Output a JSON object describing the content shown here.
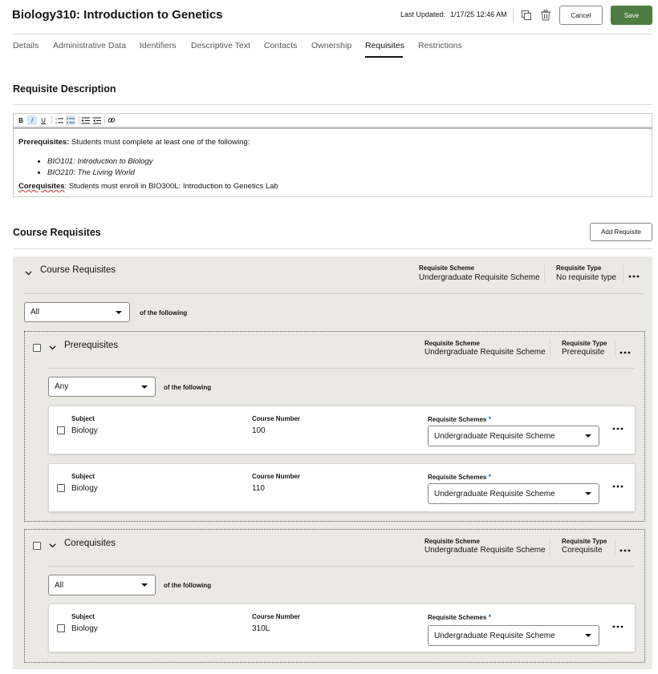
{
  "header": {
    "title": "Biology310: Introduction to Genetics",
    "last_updated_label": "Last Updated:",
    "last_updated_value": "1/17/25 12:46 AM",
    "cancel_label": "Cancel",
    "save_label": "Save"
  },
  "tabs": [
    {
      "label": "Details"
    },
    {
      "label": "Administrative Data"
    },
    {
      "label": "Identifiers"
    },
    {
      "label": "Descriptive Text"
    },
    {
      "label": "Contacts"
    },
    {
      "label": "Ownership"
    },
    {
      "label": "Requisites",
      "active": true
    },
    {
      "label": "Restrictions"
    }
  ],
  "requisite_description": {
    "title": "Requisite Description",
    "toolbar": [
      "B",
      "I",
      "U"
    ],
    "prereq_label": "Prerequisites:",
    "prereq_text": "Students must complete at least one of the following:",
    "bullets": [
      "BIO101: Introduction to Biology",
      "BIO210: The Living World"
    ],
    "coreq_label": "Corequisites",
    "coreq_text": ": Students must enroll in BIO300L: Introduction to Genetics Lab"
  },
  "course_requisites": {
    "title": "Course Requisites",
    "add_button": "Add Requisite",
    "group": {
      "title": "Course Requisites",
      "scheme_label": "Requisite Scheme",
      "scheme_value": "Undergraduate Requisite Scheme",
      "type_label": "Requisite Type",
      "type_value": "No requisite type",
      "operator": "All",
      "of_following": "of the following"
    },
    "prerequisites": {
      "title": "Prerequisites",
      "scheme_label": "Requisite Scheme",
      "scheme_value": "Undergraduate Requisite Scheme",
      "type_label": "Requisite Type",
      "type_value": "Prerequisite",
      "operator": "Any",
      "of_following": "of the following",
      "courses": [
        {
          "subject_label": "Subject",
          "subject": "Biology",
          "number_label": "Course Number",
          "number": "100",
          "schemes_label": "Requisite Schemes",
          "scheme": "Undergraduate Requisite Scheme"
        },
        {
          "subject_label": "Subject",
          "subject": "Biology",
          "number_label": "Course Number",
          "number": "110",
          "schemes_label": "Requisite Schemes",
          "scheme": "Undergraduate Requisite Scheme"
        }
      ]
    },
    "corequisites": {
      "title": "Corequisites",
      "scheme_label": "Requisite Scheme",
      "scheme_value": "Undergraduate Requisite Scheme",
      "type_label": "Requisite Type",
      "type_value": "Corequisite",
      "operator": "All",
      "of_following": "of the following",
      "courses": [
        {
          "subject_label": "Subject",
          "subject": "Biology",
          "number_label": "Course Number",
          "number": "310L",
          "schemes_label": "Requisite Schemes",
          "scheme": "Undergraduate Requisite Scheme"
        }
      ]
    }
  },
  "colors": {
    "primary_button": "#4f7d41",
    "group_background": "#ebe9e6",
    "required_star": "#2b6ec0"
  }
}
